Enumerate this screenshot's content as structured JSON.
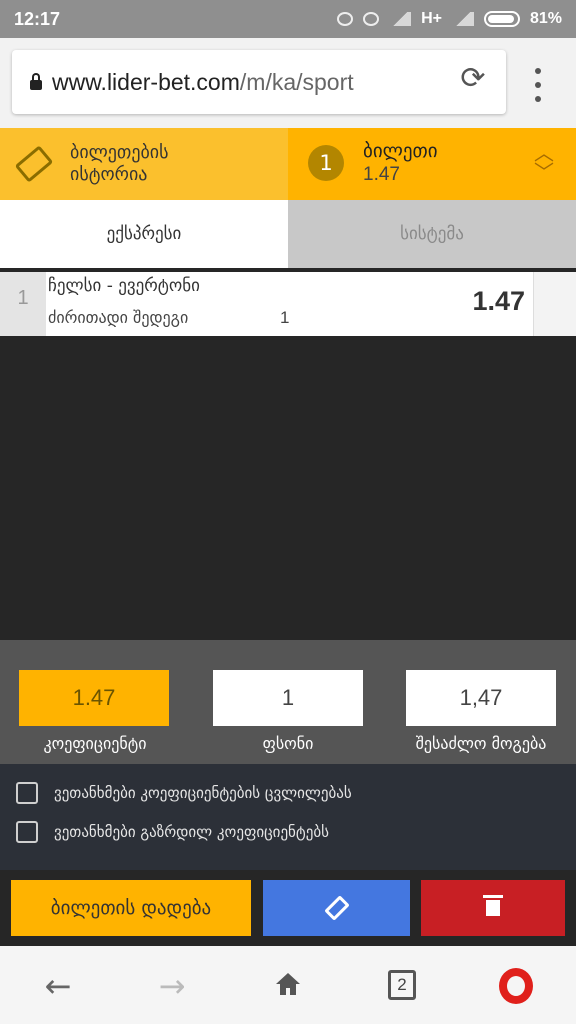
{
  "status_bar": {
    "time": "12:17",
    "network": "H+",
    "battery": "81%"
  },
  "browser": {
    "url_host": "www.lider-bet.com",
    "url_path": "/m/ka/sport"
  },
  "header": {
    "history_label_line1": "ბილეთების",
    "history_label_line2": "ისტორია",
    "ticket_count": "1",
    "ticket_title": "ბილეთი",
    "ticket_odds": "1.47"
  },
  "tabs": {
    "express": "ექსპრესი",
    "system": "სისტემა"
  },
  "bet": {
    "index": "1",
    "match": "ჩელსი - ევერტონი",
    "market": "ძირითადი შედეგი",
    "selection": "1",
    "odds": "1.47"
  },
  "summary": {
    "coefficient_value": "1.47",
    "coefficient_label": "კოეფიციენტი",
    "stake_value": "1",
    "stake_label": "ფსონი",
    "win_value": "1,47",
    "win_label": "შესაძლო მოგება"
  },
  "consent": {
    "accept_changes": "ვეთანხმები კოეფიციენტების ცვლილებას",
    "accept_increased": "ვეთანხმები გაზრდილ კოეფიციენტებს"
  },
  "actions": {
    "place_bet": "ბილეთის დადება"
  },
  "nav": {
    "tab_count": "2"
  },
  "colors": {
    "accent_yellow": "#ffb300",
    "accent_blue": "#4477e0",
    "danger_red": "#c81f24"
  }
}
